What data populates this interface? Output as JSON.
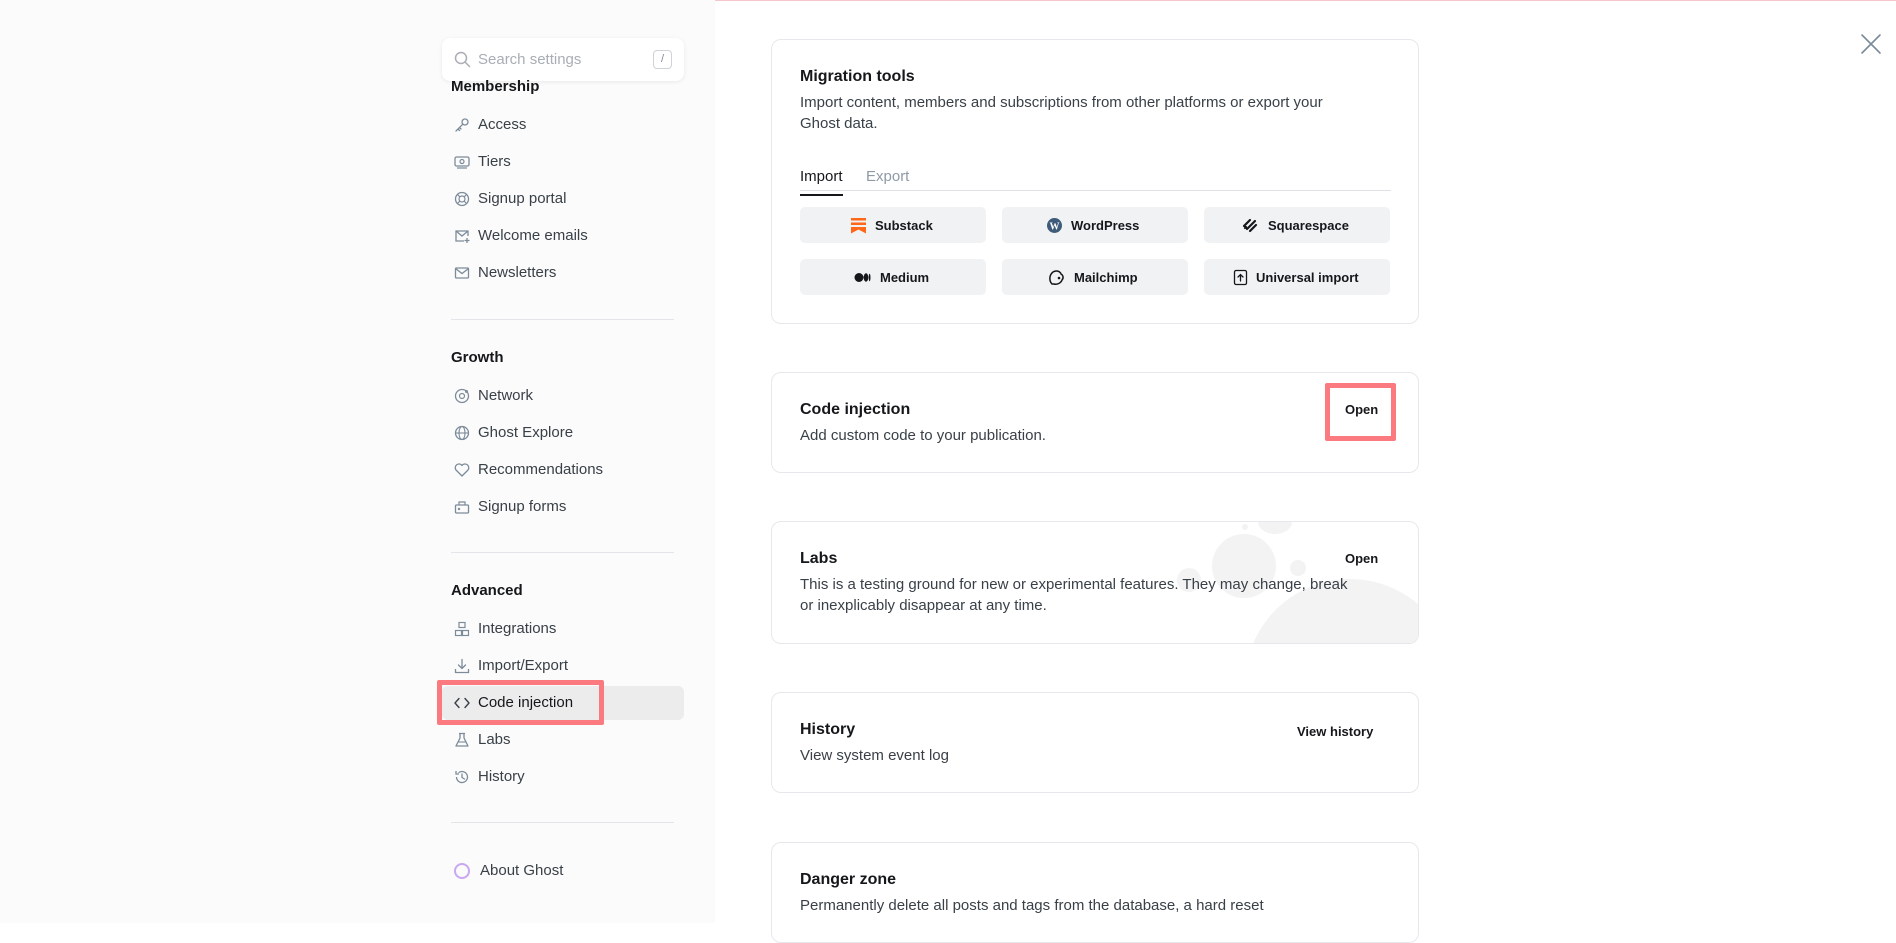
{
  "search": {
    "placeholder": "Search settings",
    "shortcut": "/"
  },
  "sidebar": {
    "membership": {
      "title": "Membership",
      "items": [
        {
          "label": "Access",
          "icon": "key-icon"
        },
        {
          "label": "Tiers",
          "icon": "tiers-icon"
        },
        {
          "label": "Signup portal",
          "icon": "portal-icon"
        },
        {
          "label": "Welcome emails",
          "icon": "mail-plus-icon"
        },
        {
          "label": "Newsletters",
          "icon": "mail-icon"
        }
      ]
    },
    "growth": {
      "title": "Growth",
      "items": [
        {
          "label": "Network",
          "icon": "network-icon"
        },
        {
          "label": "Ghost Explore",
          "icon": "globe-icon"
        },
        {
          "label": "Recommendations",
          "icon": "heart-icon"
        },
        {
          "label": "Signup forms",
          "icon": "signup-form-icon"
        }
      ]
    },
    "advanced": {
      "title": "Advanced",
      "items": [
        {
          "label": "Integrations",
          "icon": "integrations-icon"
        },
        {
          "label": "Import/Export",
          "icon": "download-icon"
        },
        {
          "label": "Code injection",
          "icon": "code-icon"
        },
        {
          "label": "Labs",
          "icon": "flask-icon"
        },
        {
          "label": "History",
          "icon": "history-icon"
        }
      ]
    },
    "about": {
      "label": "About Ghost",
      "icon": "ghost-logo-icon"
    },
    "active_item": "Code injection"
  },
  "migration": {
    "title": "Migration tools",
    "description": "Import content, members and subscriptions from other platforms or export your Ghost data.",
    "tabs": [
      "Import",
      "Export"
    ],
    "active_tab": "Import",
    "buttons": [
      {
        "label": "Substack",
        "icon": "substack-icon"
      },
      {
        "label": "WordPress",
        "icon": "wordpress-icon"
      },
      {
        "label": "Squarespace",
        "icon": "squarespace-icon"
      },
      {
        "label": "Medium",
        "icon": "medium-icon"
      },
      {
        "label": "Mailchimp",
        "icon": "mailchimp-icon"
      },
      {
        "label": "Universal import",
        "icon": "upload-icon"
      }
    ]
  },
  "code_injection": {
    "title": "Code injection",
    "description": "Add custom code to your publication.",
    "action": "Open"
  },
  "labs": {
    "title": "Labs",
    "description": "This is a testing ground for new or experimental features. They may change, break or inexplicably disappear at any time.",
    "action": "Open"
  },
  "history": {
    "title": "History",
    "description": "View system event log",
    "action": "View history"
  },
  "danger": {
    "title": "Danger zone",
    "description": "Permanently delete all posts and tags from the database, a hard reset"
  },
  "colors": {
    "highlight": "#fb7a7f",
    "active_bg": "#ececed",
    "substack": "#ff6719"
  }
}
